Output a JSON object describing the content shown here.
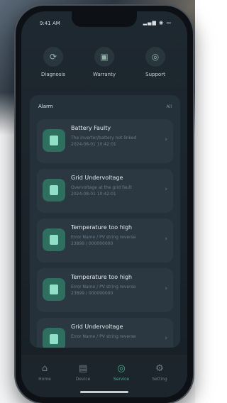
{
  "status": {
    "time": "9:41 AM",
    "icons": "▂▄▆ ◉ ▭"
  },
  "quick_actions": [
    {
      "label": "Diagnosis",
      "icon": "diagnosis-icon",
      "glyph": "⟳"
    },
    {
      "label": "Warranty",
      "icon": "warranty-icon",
      "glyph": "▣"
    },
    {
      "label": "Support",
      "icon": "support-icon",
      "glyph": "◎"
    }
  ],
  "alarm": {
    "title": "Alarm",
    "all_label": "All",
    "items": [
      {
        "title": "Battery Faulty",
        "line1": "The inverter/battery not linked",
        "line2": "2024-08-01 10:42:01",
        "icon": "battery-icon"
      },
      {
        "title": "Grid Undervoltage",
        "line1": "Overvoltage at the grid fault",
        "line2": "2024-08-01 10:42:01",
        "icon": "grid-icon"
      },
      {
        "title": "Temperature too high",
        "line1": "Error Name / PV string reverse",
        "line2": "23899 / 000000000",
        "icon": "temperature-icon"
      },
      {
        "title": "Temperature too high",
        "line1": "Error Name / PV string reverse",
        "line2": "23899 / 000000000",
        "icon": "temperature-icon"
      },
      {
        "title": "Grid Undervoltage",
        "line1": "Error Name / PV string reverse",
        "line2": "",
        "icon": "grid-icon"
      }
    ]
  },
  "tabs": [
    {
      "label": "Home",
      "glyph": "⌂",
      "icon": "home-icon"
    },
    {
      "label": "Device",
      "glyph": "▤",
      "icon": "device-icon"
    },
    {
      "label": "Service",
      "glyph": "◎",
      "icon": "service-icon"
    },
    {
      "label": "Setting",
      "glyph": "⚙",
      "icon": "setting-icon"
    }
  ],
  "colors": {
    "accent": "#3fb08f",
    "card": "#24303a",
    "icon_bg": "#2f6f5f"
  }
}
